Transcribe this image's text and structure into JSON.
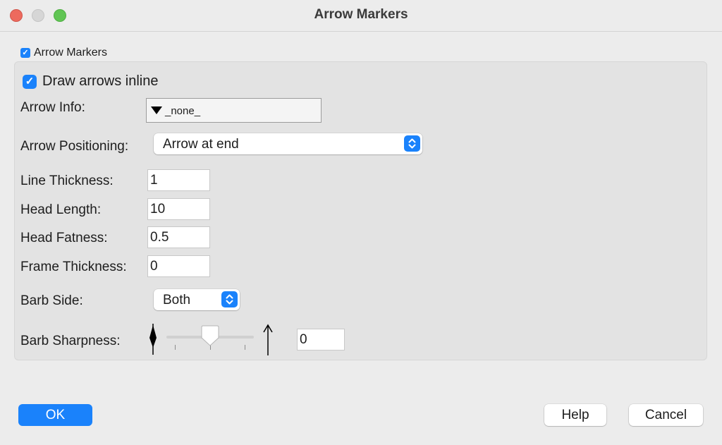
{
  "window": {
    "title": "Arrow Markers"
  },
  "arrow_markers": {
    "checked": true,
    "label": "Arrow Markers"
  },
  "draw_inline": {
    "checked": true,
    "label": "Draw arrows inline"
  },
  "arrow_info": {
    "label": "Arrow Info:",
    "value": "_none_"
  },
  "arrow_positioning": {
    "label": "Arrow Positioning:",
    "value": "Arrow at end"
  },
  "line_thickness": {
    "label": "Line Thickness:",
    "value": "1"
  },
  "head_length": {
    "label": "Head Length:",
    "value": "10"
  },
  "head_fatness": {
    "label": "Head Fatness:",
    "value": "0.5"
  },
  "frame_thickness": {
    "label": "Frame Thickness:",
    "value": "0"
  },
  "barb_side": {
    "label": "Barb Side:",
    "value": "Both"
  },
  "barb_sharpness": {
    "label": "Barb Sharpness:",
    "value": "0",
    "slider_fraction": 0.5
  },
  "buttons": {
    "ok": "OK",
    "help": "Help",
    "cancel": "Cancel"
  },
  "colors": {
    "accent": "#1a82fb",
    "close": "#ed6a5e",
    "zoom": "#61c554"
  },
  "icons": {
    "check": "checkmark-icon",
    "stepper": "up-down-chevrons-icon",
    "disclosure": "down-triangle-icon"
  }
}
